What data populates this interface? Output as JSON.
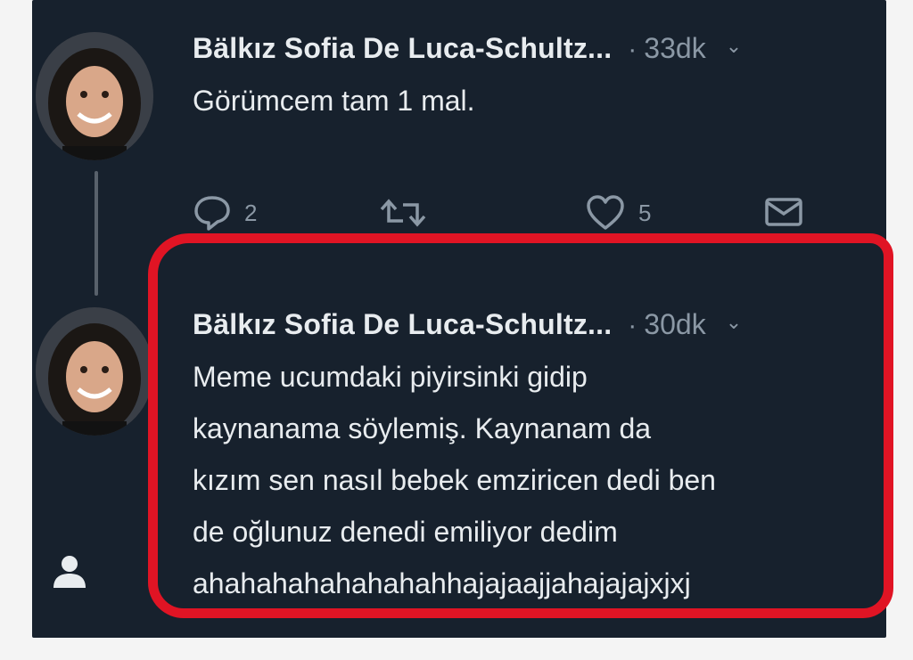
{
  "colors": {
    "background": "#17212d",
    "text": "#e8ecef",
    "muted": "#8b98a5",
    "highlight": "#e01424"
  },
  "tweets": [
    {
      "author": "Bälkız Sofia De Luca-Schultz...",
      "separator": "·",
      "time": "33dk",
      "text": "Görümcem tam 1 mal.",
      "actions": {
        "reply_count": "2",
        "retweet_count": "",
        "like_count": "5"
      }
    },
    {
      "author": "Bälkız Sofia De Luca-Schultz...",
      "separator": "·",
      "time": "30dk",
      "text": "Meme ucumdaki piyirsinki gidip\nkaynanama söylemiş. Kaynanam da\nkızım sen nasıl bebek emziricen dedi ben\nde oğlunuz denedi emiliyor dedim\nahahahahahahahahhajajaajjahajajajxjxj"
    }
  ],
  "icons": {
    "reply": "reply-icon",
    "retweet": "retweet-icon",
    "like": "heart-icon",
    "dm": "envelope-icon",
    "more": "chevron-down-icon",
    "profile": "person-icon"
  }
}
